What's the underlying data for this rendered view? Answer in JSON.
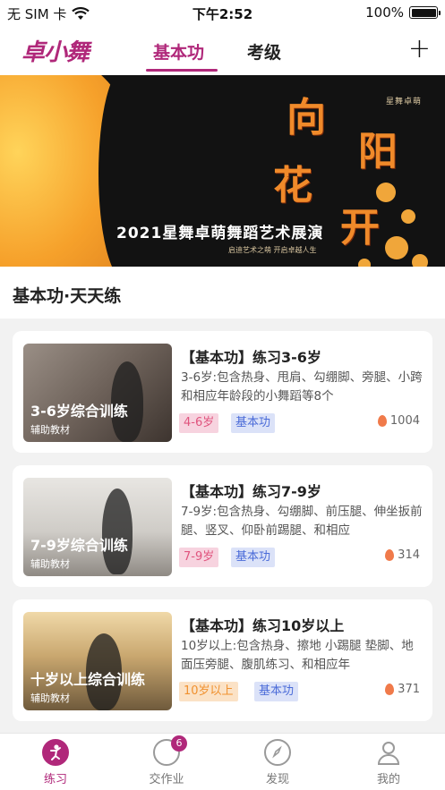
{
  "status": {
    "carrier": "无 SIM 卡",
    "time": "下午2:52",
    "battery": "100%"
  },
  "nav": {
    "logo": "卓小舞",
    "tabs": [
      {
        "label": "基本功"
      },
      {
        "label": "考级"
      }
    ],
    "add": "+"
  },
  "banner": {
    "title_chars": [
      "向",
      "阳",
      "花",
      "开"
    ],
    "caption": "2021星舞卓萌舞蹈艺术展演",
    "brand": "星舞卓萌",
    "sub": "启迪艺术之萌  开启卓越人生"
  },
  "section": {
    "title": "基本功·天天练"
  },
  "courses": [
    {
      "thumb_title": "3-6岁综合训练",
      "thumb_sub": "辅助教材",
      "title": "【基本功】练习3-6岁",
      "desc": "3-6岁:包含热身、甩肩、勾绷脚、旁腿、小跨和相应年龄段的小舞蹈等8个",
      "age_tag": "4-6岁",
      "type_tag": "基本功",
      "views": "1004"
    },
    {
      "thumb_title": "7-9岁综合训练",
      "thumb_sub": "辅助教材",
      "title": "【基本功】练习7-9岁",
      "desc": "7-9岁:包含热身、勾绷脚、前压腿、伸坐扳前腿、竖叉、仰卧前踢腿、和相应",
      "age_tag": "7-9岁",
      "type_tag": "基本功",
      "views": "314"
    },
    {
      "thumb_title": "十岁以上综合训练",
      "thumb_sub": "辅助教材",
      "title": "【基本功】练习10岁以上",
      "desc": "10岁以上:包含热身、擦地 小踢腿 垫脚、地面压旁腿、腹肌练习、和相应年",
      "age_tag": "10岁以上",
      "type_tag": "基本功",
      "views": "371"
    }
  ],
  "tabbar": {
    "items": [
      {
        "label": "练习",
        "icon": "dancer-icon"
      },
      {
        "label": "交作业",
        "icon": "homework-icon",
        "badge": "6"
      },
      {
        "label": "发现",
        "icon": "compass-icon"
      },
      {
        "label": "我的",
        "icon": "person-icon"
      }
    ]
  },
  "colors": {
    "accent": "#b0287a",
    "banner_bg": "#121212",
    "banner_gold": "#f6a12b"
  }
}
